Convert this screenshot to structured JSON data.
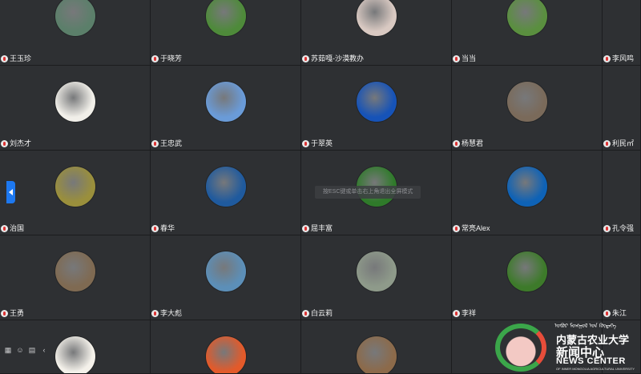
{
  "participants": [
    {
      "name": "王玉珍",
      "avatar": "avatar-woman-photo",
      "color": "#5b7f6a"
    },
    {
      "name": "于晓芳",
      "avatar": "avatar-trees-photo",
      "color": "#4e8a3a"
    },
    {
      "name": "苏茹嘎-沙漠教办",
      "avatar": "avatar-cartoon-dog-photo",
      "color": "#d9c9c2"
    },
    {
      "name": "当当",
      "avatar": "avatar-plant-photo",
      "color": "#5a8f3f"
    },
    {
      "name": "李风鸣",
      "avatar": "",
      "color": ""
    },
    {
      "name": "刘杰才",
      "avatar": "avatar-dog-photo",
      "color": "#f1efe9"
    },
    {
      "name": "王忠武",
      "avatar": "avatar-panda-mascot",
      "color": "#6a9bd8"
    },
    {
      "name": "于翠英",
      "avatar": "avatar-blue-logo",
      "color": "#1653b8"
    },
    {
      "name": "杨慧君",
      "avatar": "avatar-succulent-photo",
      "color": "#7a6a5a"
    },
    {
      "name": "利民㎡",
      "avatar": "",
      "color": ""
    },
    {
      "name": "治国",
      "avatar": "avatar-food-photo",
      "color": "#9a8f3c"
    },
    {
      "name": "春华",
      "avatar": "avatar-university-seal",
      "color": "#1f5a9e"
    },
    {
      "name": "屈丰富",
      "avatar": "avatar-leaves-photo",
      "color": "#2f7a2a"
    },
    {
      "name": "常亮Alex",
      "avatar": "avatar-panda-cartoon",
      "color": "#0e62b6"
    },
    {
      "name": "孔令强",
      "avatar": "",
      "color": ""
    },
    {
      "name": "王勇",
      "avatar": "avatar-man-photo",
      "color": "#7f6a52"
    },
    {
      "name": "李大彪",
      "avatar": "avatar-landscape-photo",
      "color": "#5c8fb8"
    },
    {
      "name": "白云莉",
      "avatar": "avatar-grassland-photo",
      "color": "#8e9a8a"
    },
    {
      "name": "李祥",
      "avatar": "avatar-flower-photo",
      "color": "#3d7a2a"
    },
    {
      "name": "朱江",
      "avatar": "",
      "color": ""
    },
    {
      "name": "",
      "avatar": "avatar-drawing",
      "color": "#f4f1ea"
    },
    {
      "name": "",
      "avatar": "avatar-child-photo",
      "color": "#e35a2a"
    },
    {
      "name": "",
      "avatar": "avatar-deer-photo",
      "color": "#8c6a4a"
    },
    {
      "name": "",
      "avatar": "",
      "color": ""
    },
    {
      "name": "",
      "avatar": "",
      "color": ""
    }
  ],
  "esc_hint": "按ESC键或单击右上角退出全屏模式",
  "side_handle": {
    "icon": "chevron-left-icon"
  },
  "bottom_tools": [
    {
      "icon": "grid-view-icon"
    },
    {
      "icon": "chat-icon"
    },
    {
      "icon": "message-icon"
    },
    {
      "icon": "chevron-left-icon"
    }
  ],
  "watermark": {
    "mongolian": "ᠤᠪᠤᠷ ᠮᠣᠩᠭᠣᠯ ᠤᠨ ᠬᠥᠳᠡᠭᠡ",
    "school": "内蒙古农业大学",
    "center": "新闻中心",
    "news": "NEWS CENTER",
    "english": "OF INNER MONGOLIA AGRICULTURAL UNIVERSITY",
    "brand_green": "#3ba64a",
    "brand_red": "#e74d3a"
  }
}
